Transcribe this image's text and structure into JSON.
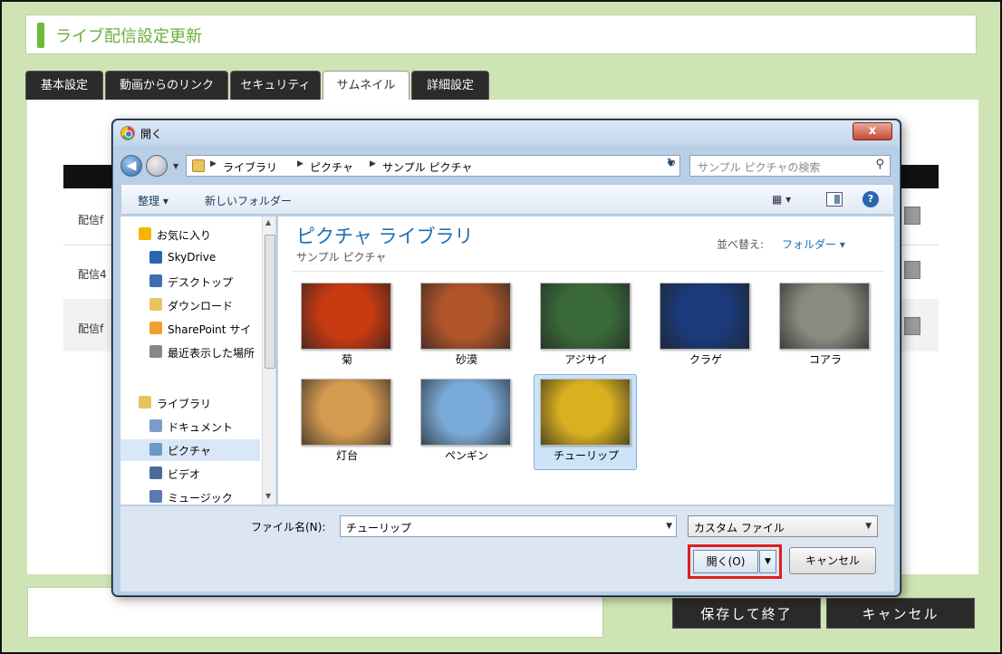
{
  "page": {
    "title": "ライブ配信設定更新",
    "tabs": [
      {
        "label": "基本設定"
      },
      {
        "label": "動画からのリンク"
      },
      {
        "label": "セキュリティ"
      },
      {
        "label": "サムネイル"
      },
      {
        "label": "詳細設定"
      }
    ],
    "active_tab": "サムネイル",
    "rows": [
      {
        "label": "配信f"
      },
      {
        "label": "配信4"
      },
      {
        "label": "配信f"
      }
    ],
    "save_label": "保存して終了",
    "cancel_label": "キャンセル",
    "accent_color": "#6aae3c",
    "background_color": "#cfe4b5"
  },
  "dialog": {
    "title": "開く",
    "close_label": "x",
    "breadcrumbs": [
      "ライブラリ",
      "ピクチャ",
      "サンプル ピクチャ"
    ],
    "search_placeholder": "サンプル ピクチャの検索",
    "toolbar": {
      "organize_label": "整理 ▾",
      "new_folder_label": "新しいフォルダー",
      "view_label": "▾"
    },
    "nav": {
      "items": [
        {
          "label": "お気に入り",
          "icon": "star-icon",
          "color": "#f5b400"
        },
        {
          "label": "SkyDrive",
          "icon": "cloud-icon",
          "color": "#2a66b0"
        },
        {
          "label": "デスクトップ",
          "icon": "desktop-icon",
          "color": "#3d6fb0"
        },
        {
          "label": "ダウンロード",
          "icon": "download-folder-icon",
          "color": "#e8c45c"
        },
        {
          "label": "SharePoint サイ",
          "icon": "sharepoint-icon",
          "color": "#f0a030"
        },
        {
          "label": "最近表示した場所",
          "icon": "recent-places-icon",
          "color": "#888888"
        },
        {
          "label": "ライブラリ",
          "icon": "library-icon",
          "color": "#e8c45c"
        },
        {
          "label": "ドキュメント",
          "icon": "documents-icon",
          "color": "#7a9cc8"
        },
        {
          "label": "ピクチャ",
          "icon": "pictures-icon",
          "color": "#6a9ac8"
        },
        {
          "label": "ビデオ",
          "icon": "videos-icon",
          "color": "#4a6a9a"
        },
        {
          "label": "ミュージック",
          "icon": "music-icon",
          "color": "#5a7ab0"
        }
      ],
      "selected": "ピクチャ"
    },
    "library": {
      "title": "ピクチャ ライブラリ",
      "subtitle": "サンプル ピクチャ",
      "sort_label": "並べ替え:",
      "sort_value": "フォルダー ▾"
    },
    "files": [
      {
        "name": "菊",
        "color": "#c83a12"
      },
      {
        "name": "砂漠",
        "color": "#b0552a"
      },
      {
        "name": "アジサイ",
        "color": "#3a6a3a"
      },
      {
        "name": "クラゲ",
        "color": "#1a3a7a"
      },
      {
        "name": "コアラ",
        "color": "#8a8a80"
      },
      {
        "name": "灯台",
        "color": "#d49a50"
      },
      {
        "name": "ペンギン",
        "color": "#7aaad8"
      },
      {
        "name": "チューリップ",
        "color": "#d8b020"
      }
    ],
    "selected_file": "チューリップ",
    "filename_label": "ファイル名(N):",
    "filename_value": "チューリップ",
    "filter_value": "カスタム ファイル",
    "open_label": "開く(O)",
    "cancel_label": "キャンセル"
  }
}
